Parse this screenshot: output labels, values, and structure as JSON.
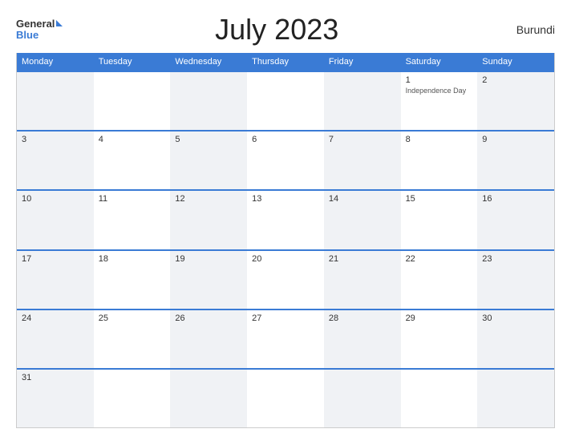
{
  "header": {
    "title": "July 2023",
    "country": "Burundi",
    "logo_general": "General",
    "logo_blue": "Blue"
  },
  "weekdays": [
    "Monday",
    "Tuesday",
    "Wednesday",
    "Thursday",
    "Friday",
    "Saturday",
    "Sunday"
  ],
  "weeks": [
    [
      {
        "day": "",
        "event": ""
      },
      {
        "day": "",
        "event": ""
      },
      {
        "day": "",
        "event": ""
      },
      {
        "day": "",
        "event": ""
      },
      {
        "day": "",
        "event": ""
      },
      {
        "day": "1",
        "event": "Independence Day"
      },
      {
        "day": "2",
        "event": ""
      }
    ],
    [
      {
        "day": "3",
        "event": ""
      },
      {
        "day": "4",
        "event": ""
      },
      {
        "day": "5",
        "event": ""
      },
      {
        "day": "6",
        "event": ""
      },
      {
        "day": "7",
        "event": ""
      },
      {
        "day": "8",
        "event": ""
      },
      {
        "day": "9",
        "event": ""
      }
    ],
    [
      {
        "day": "10",
        "event": ""
      },
      {
        "day": "11",
        "event": ""
      },
      {
        "day": "12",
        "event": ""
      },
      {
        "day": "13",
        "event": ""
      },
      {
        "day": "14",
        "event": ""
      },
      {
        "day": "15",
        "event": ""
      },
      {
        "day": "16",
        "event": ""
      }
    ],
    [
      {
        "day": "17",
        "event": ""
      },
      {
        "day": "18",
        "event": ""
      },
      {
        "day": "19",
        "event": ""
      },
      {
        "day": "20",
        "event": ""
      },
      {
        "day": "21",
        "event": ""
      },
      {
        "day": "22",
        "event": ""
      },
      {
        "day": "23",
        "event": ""
      }
    ],
    [
      {
        "day": "24",
        "event": ""
      },
      {
        "day": "25",
        "event": ""
      },
      {
        "day": "26",
        "event": ""
      },
      {
        "day": "27",
        "event": ""
      },
      {
        "day": "28",
        "event": ""
      },
      {
        "day": "29",
        "event": ""
      },
      {
        "day": "30",
        "event": ""
      }
    ],
    [
      {
        "day": "31",
        "event": ""
      },
      {
        "day": "",
        "event": ""
      },
      {
        "day": "",
        "event": ""
      },
      {
        "day": "",
        "event": ""
      },
      {
        "day": "",
        "event": ""
      },
      {
        "day": "",
        "event": ""
      },
      {
        "day": "",
        "event": ""
      }
    ]
  ]
}
